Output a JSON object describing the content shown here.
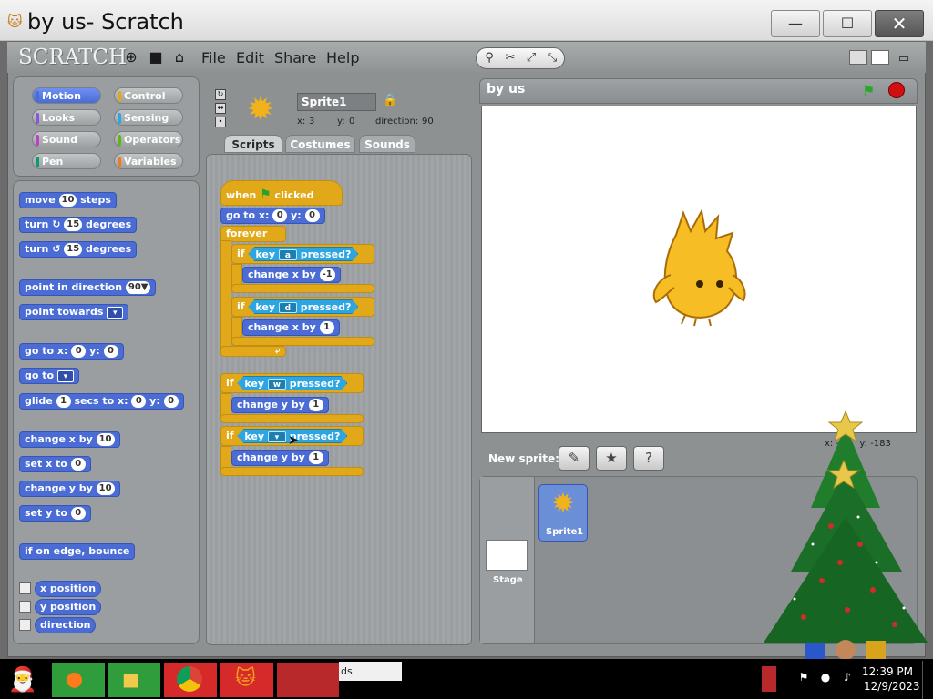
{
  "window": {
    "title": "by us- Scratch",
    "min_glyph": "—",
    "max_glyph": "☐",
    "close_glyph": "✕"
  },
  "app": {
    "logo": "SCRATCH",
    "menus": [
      "File",
      "Edit",
      "Share",
      "Help"
    ]
  },
  "categories": [
    {
      "label": "Motion",
      "color": "#4a6cd4",
      "selected": true
    },
    {
      "label": "Control",
      "color": "#e1a91a"
    },
    {
      "label": "Looks",
      "color": "#8a55d7"
    },
    {
      "label": "Sensing",
      "color": "#2ca5e2"
    },
    {
      "label": "Sound",
      "color": "#bb42c3"
    },
    {
      "label": "Operators",
      "color": "#5cb712"
    },
    {
      "label": "Pen",
      "color": "#0e9a6c"
    },
    {
      "label": "Variables",
      "color": "#ee7d16"
    }
  ],
  "palette": {
    "move": {
      "pre": "move",
      "val": "10",
      "post": "steps"
    },
    "turn_cw": {
      "pre": "turn",
      "val": "15",
      "post": "degrees"
    },
    "turn_ccw": {
      "pre": "turn",
      "val": "15",
      "post": "degrees"
    },
    "point_dir": {
      "pre": "point in direction",
      "val": "90▼"
    },
    "point_towards": {
      "pre": "point towards"
    },
    "goto_xy": {
      "pre": "go to x:",
      "x": "0",
      "mid": "y:",
      "y": "0"
    },
    "goto": {
      "pre": "go to"
    },
    "glide": {
      "pre": "glide",
      "secs": "1",
      "mid": "secs to x:",
      "x": "0",
      "mid2": "y:",
      "y": "0"
    },
    "change_x": {
      "pre": "change x by",
      "val": "10"
    },
    "set_x": {
      "pre": "set x to",
      "val": "0"
    },
    "change_y": {
      "pre": "change y by",
      "val": "10"
    },
    "set_y": {
      "pre": "set y to",
      "val": "0"
    },
    "bounce": "if on edge, bounce",
    "reporters": [
      "x position",
      "y position",
      "direction"
    ]
  },
  "sprite": {
    "name": "Sprite1",
    "x_label": "x:",
    "x": "3",
    "y_label": "y:",
    "y": "0",
    "dir_label": "direction:",
    "dir": "90",
    "tabs": [
      "Scripts",
      "Costumes",
      "Sounds"
    ]
  },
  "scripts": {
    "when": "when",
    "clicked": "clicked",
    "goto": {
      "pre": "go to x:",
      "x": "0",
      "mid": "y:",
      "y": "0"
    },
    "forever": "forever",
    "if": "if",
    "key": "key",
    "pressed": "pressed?",
    "key_a": "a",
    "key_d": "d",
    "key_w": "w",
    "change_x_by": "change x by",
    "change_y_by": "change y by",
    "neg1": "-1",
    "one": "1"
  },
  "stage": {
    "title": "by us",
    "x_label": "x:",
    "x": "-...",
    "y_label": "y:",
    "y": "-183",
    "new_sprite_label": "New sprite:",
    "stage_label": "Stage",
    "sprite_tile_label": "Sprite1"
  },
  "taskbar": {
    "field_text": "ds",
    "time": "12:39 PM",
    "date": "12/9/2023"
  }
}
